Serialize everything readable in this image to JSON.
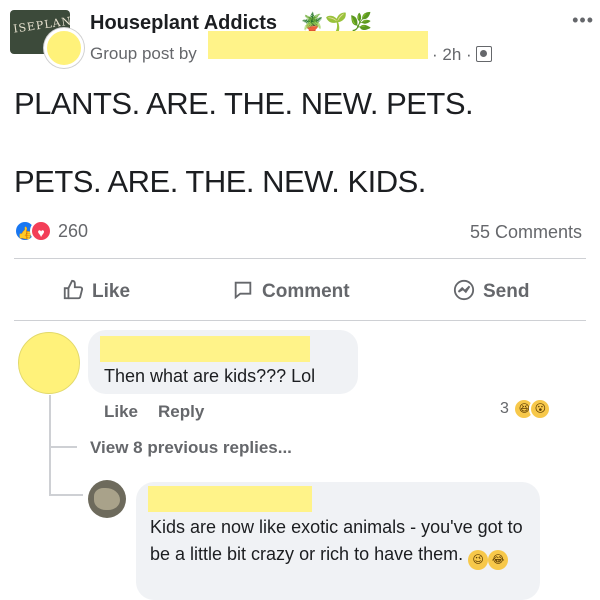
{
  "post": {
    "group_name": "Houseplant Addicts",
    "group_icons": "🪴🌱🌿",
    "group_avatar_text": "ISEPLANT",
    "meta_prefix": "Group post by",
    "meta_time": "· 2h ·",
    "more_label": "•••",
    "text_line_1": "PLANTS. ARE. THE. NEW. PETS.",
    "text_line_2": "PETS. ARE. THE. NEW. KIDS.",
    "reaction_count": "260",
    "comments_count": "55 Comments"
  },
  "actions": {
    "like": "Like",
    "comment": "Comment",
    "send": "Send"
  },
  "comment_1": {
    "text": "Then what are kids??? Lol",
    "like": "Like",
    "reply": "Reply",
    "reaction_count": "3",
    "reaction_emoji_1": "😆",
    "reaction_emoji_2": "😮"
  },
  "view_replies": "View 8 previous replies...",
  "comment_2": {
    "text_main": "Kids are now like exotic animals - you've got to be a little bit crazy or rich to have them.",
    "emoji_1": "😉",
    "emoji_2": "😂"
  },
  "colors": {
    "redaction": "#fff389",
    "facebook_blue": "#1877f2",
    "love_red": "#f33e58",
    "bubble_gray": "#f0f2f5",
    "meta_gray": "#65676b"
  }
}
